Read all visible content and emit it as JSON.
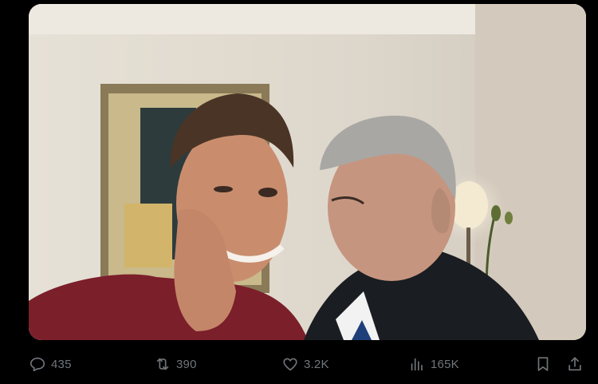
{
  "post": {
    "media": {
      "alt": "",
      "icon": "photo"
    },
    "actions": {
      "reply": {
        "icon": "reply-icon",
        "count": "435"
      },
      "retweet": {
        "icon": "retweet-icon",
        "count": "390"
      },
      "like": {
        "icon": "heart-icon",
        "count": "3.2K"
      },
      "views": {
        "icon": "views-icon",
        "count": "165K"
      },
      "bookmark": {
        "icon": "bookmark-icon"
      },
      "share": {
        "icon": "share-icon"
      }
    }
  },
  "colors": {
    "background": "#000000",
    "action_text": "#71767b"
  }
}
